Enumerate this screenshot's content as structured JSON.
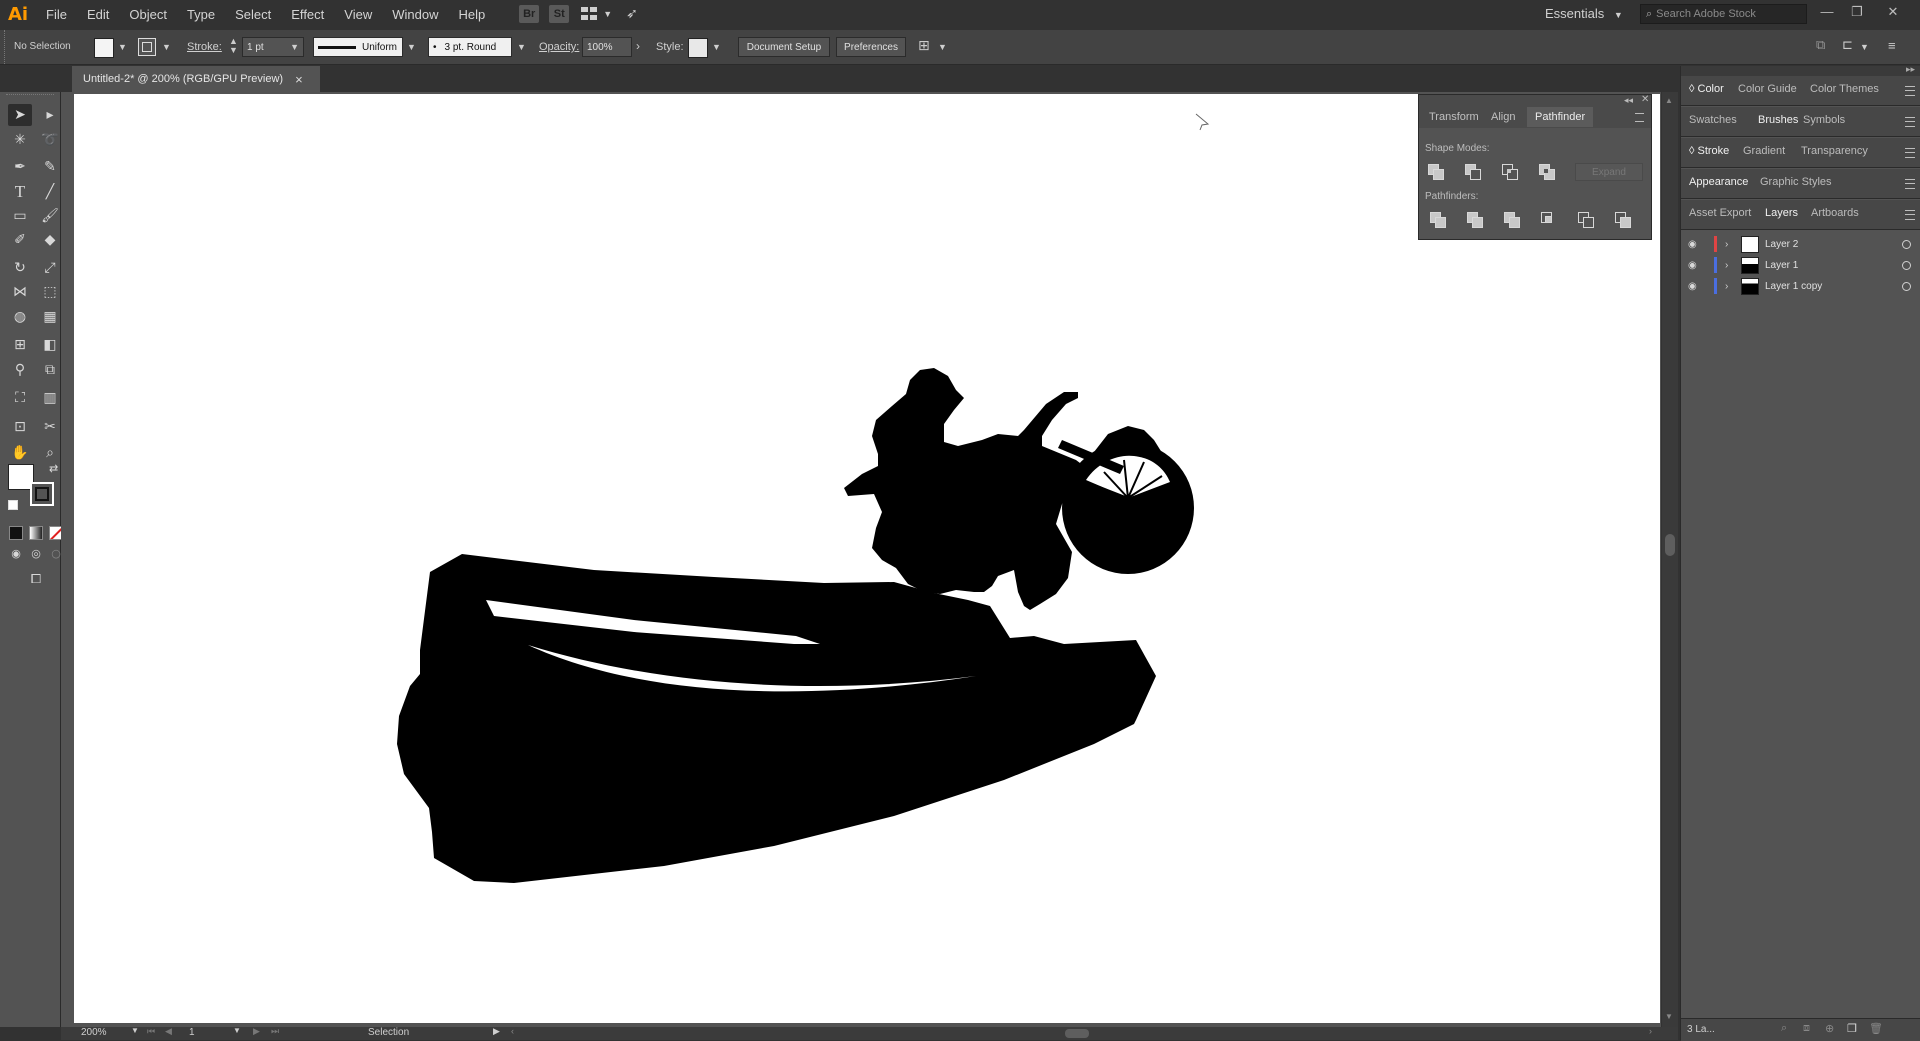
{
  "app": {
    "logo": "Ai",
    "menus": [
      "File",
      "Edit",
      "Object",
      "Type",
      "Select",
      "Effect",
      "View",
      "Window",
      "Help"
    ],
    "bridge_label": "Br",
    "stock_label": "St",
    "workspace": "Essentials",
    "search_placeholder": "Search Adobe Stock"
  },
  "control_bar": {
    "selection_status": "No Selection",
    "stroke_label": "Stroke:",
    "stroke_weight": "1 pt",
    "profile": "Uniform",
    "brush": "3 pt. Round",
    "opacity_label": "Opacity:",
    "opacity_value": "100%",
    "style_label": "Style:",
    "document_setup": "Document Setup",
    "preferences": "Preferences"
  },
  "document": {
    "tab_title": "Untitled-2* @ 200% (RGB/GPU Preview)",
    "close_glyph": "×"
  },
  "pathfinder_panel": {
    "tabs": [
      "Transform",
      "Align",
      "Pathfinder"
    ],
    "active_tab": "Pathfinder",
    "shape_modes_label": "Shape Modes:",
    "expand_label": "Expand",
    "pathfinders_label": "Pathfinders:"
  },
  "dock": {
    "group1": [
      "Color",
      "Color Guide",
      "Color Themes"
    ],
    "group2": [
      "Swatches",
      "Brushes",
      "Symbols"
    ],
    "group3": [
      "Stroke",
      "Gradient",
      "Transparency"
    ],
    "group4": [
      "Appearance",
      "Graphic Styles"
    ],
    "group5": [
      "Asset Export",
      "Layers",
      "Artboards"
    ],
    "layers": [
      {
        "name": "Layer 2",
        "color": "#e04444"
      },
      {
        "name": "Layer 1",
        "color": "#4a6ee0"
      },
      {
        "name": "Layer 1 copy",
        "color": "#4a6ee0"
      }
    ],
    "layer_count": "3 La..."
  },
  "status_bar": {
    "zoom": "200%",
    "artboard_number": "1",
    "tool_name": "Selection"
  },
  "colors": {
    "accent_logo": "#ff9a00",
    "ui_dark": "#323232",
    "ui_panel": "#535353",
    "artwork": "#000000"
  }
}
